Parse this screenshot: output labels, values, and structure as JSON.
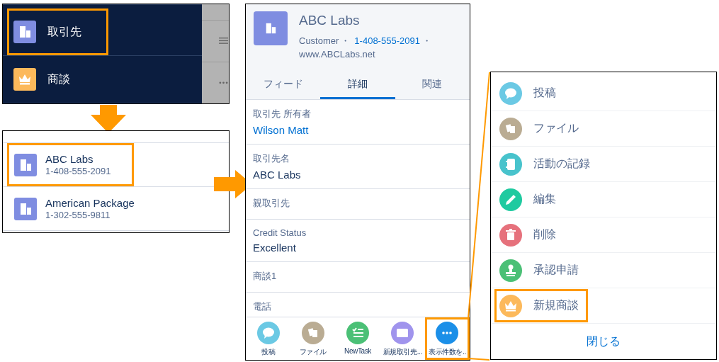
{
  "nav_menu": {
    "items": [
      {
        "label": "取引先",
        "kind": "account",
        "highlighted": true
      },
      {
        "label": "商談",
        "kind": "opportunity",
        "highlighted": false
      }
    ]
  },
  "account_list": {
    "items": [
      {
        "name": "ABC Labs",
        "phone": "1-408-555-2091",
        "kind": "account",
        "highlighted": true
      },
      {
        "name": "American Package",
        "phone": "1-302-555-9811",
        "kind": "account",
        "highlighted": false
      }
    ]
  },
  "record": {
    "title": "ABC Labs",
    "kind": "account",
    "meta": [
      {
        "text": "Customer",
        "kind": "text"
      },
      {
        "text": "・",
        "kind": "separator"
      },
      {
        "text": "1-408-555-2091",
        "kind": "link"
      },
      {
        "text": "・",
        "kind": "separator"
      },
      {
        "text": "www.ABCLabs.net",
        "kind": "text"
      }
    ],
    "tabs": [
      {
        "label": "フィード",
        "selected": false
      },
      {
        "label": "詳細",
        "selected": true
      },
      {
        "label": "関連",
        "selected": false
      }
    ],
    "fields": [
      {
        "label": "取引先 所有者",
        "value": "Wilson Matt",
        "kind": "link"
      },
      {
        "label": "取引先名",
        "value": "ABC Labs",
        "kind": "text"
      },
      {
        "label": "親取引先"
      },
      {
        "label": "Credit Status",
        "value": "Excellent",
        "kind": "text"
      },
      {
        "label": "商談1"
      },
      {
        "label": "電話"
      }
    ],
    "actions": [
      {
        "label": "投稿",
        "kind": "post",
        "highlighted": false
      },
      {
        "label": "ファイル",
        "kind": "file",
        "highlighted": false
      },
      {
        "label": "NewTask",
        "kind": "task",
        "highlighted": false
      },
      {
        "label": "新規取引先...",
        "kind": "contact",
        "highlighted": false
      },
      {
        "label": "表示件数を..",
        "kind": "more",
        "highlighted": true
      }
    ]
  },
  "action_menu": {
    "items": [
      {
        "label": "投稿",
        "kind": "post",
        "highlighted": false
      },
      {
        "label": "ファイル",
        "kind": "file",
        "highlighted": false
      },
      {
        "label": "活動の記録",
        "kind": "logcall",
        "highlighted": false
      },
      {
        "label": "編集",
        "kind": "edit",
        "highlighted": false
      },
      {
        "label": "削除",
        "kind": "delete",
        "highlighted": false
      },
      {
        "label": "承認申請",
        "kind": "approval",
        "highlighted": false
      },
      {
        "label": "新規商談",
        "kind": "opportunity",
        "highlighted": true
      }
    ],
    "close": "閉じる"
  }
}
